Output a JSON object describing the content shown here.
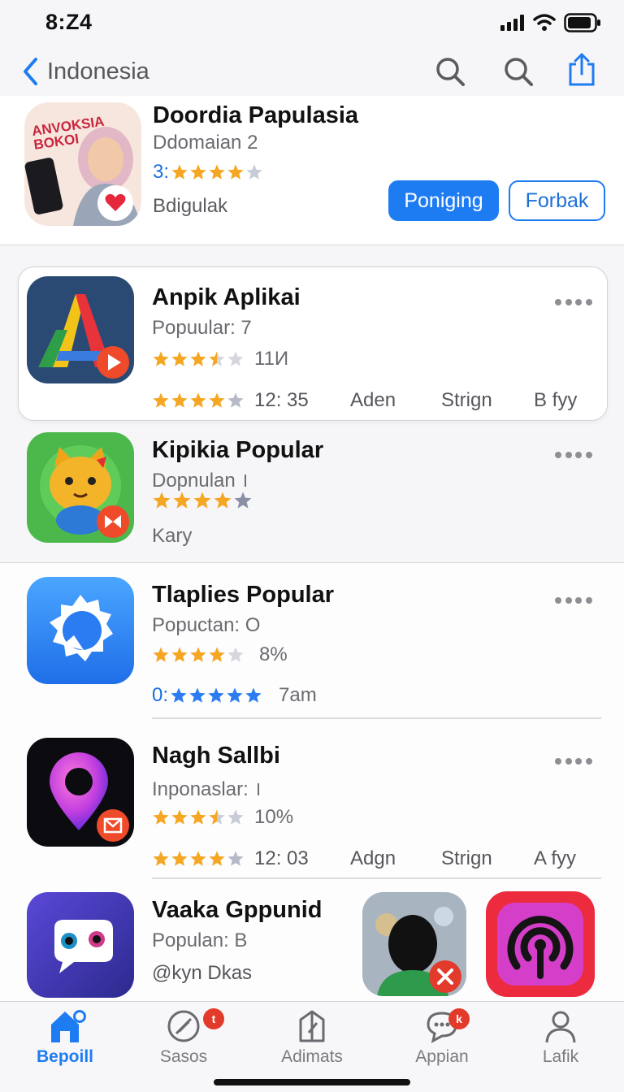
{
  "status": {
    "time": "8:Z4"
  },
  "nav": {
    "back_label": "Indonesia"
  },
  "header_app": {
    "icon_text": "ANVOKSIA BOKOI",
    "title": "Doordia Papulasia",
    "subtitle": "Ddomaian 2",
    "rating_prefix": "3:",
    "extra": "Bdigulak",
    "primary_button": "Poniging",
    "secondary_button": "Forbak"
  },
  "apps": [
    {
      "title": "Anpik Aplikai",
      "subtitle": "Popuular:  7",
      "rating_value": "11И",
      "meta": {
        "time": "12: 35",
        "col1": "Aden",
        "col2": "Strign",
        "col3": "B fyy"
      }
    },
    {
      "title": "Kipikia Popular",
      "subtitle": "Dopnulan  ।",
      "extra": "Kary"
    },
    {
      "title": "Tlaplies Popular",
      "subtitle": "Popuctan: O",
      "rating_value": "8%",
      "second_prefix": "0:",
      "second_value": "7am"
    },
    {
      "title": "Nagh Sallbi",
      "subtitle": "Inponaslar:  ।",
      "rating_value": "10%",
      "meta": {
        "time": "12: 03",
        "col1": "Adgn",
        "col2": "Strign",
        "col3": "A fyy"
      }
    },
    {
      "title": "Vaaka Gppunid",
      "subtitle": "Populan:  B",
      "extra": "@kyn Dkas"
    }
  ],
  "tabs": [
    {
      "label": "Bepoill",
      "icon": "home-icon"
    },
    {
      "label": "Sasos",
      "icon": "compass-icon",
      "badge": "t"
    },
    {
      "label": "Adimats",
      "icon": "bookmark-icon"
    },
    {
      "label": "Appian",
      "icon": "chat-icon",
      "badge": "k"
    },
    {
      "label": "Lafik",
      "icon": "person-icon"
    }
  ],
  "colors": {
    "accent": "#1e7cf2",
    "star": "#f5a623",
    "badge": "#e33b2b"
  }
}
